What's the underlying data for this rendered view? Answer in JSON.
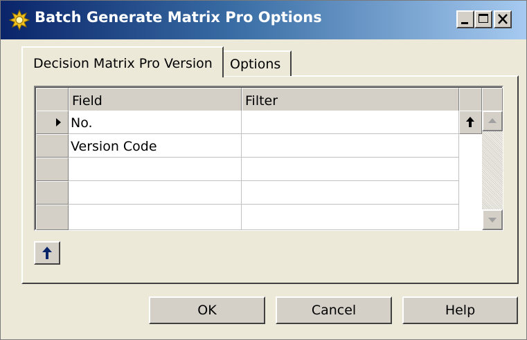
{
  "window": {
    "title": "Batch Generate Matrix Pro Options",
    "title_icon": "sun-gear-icon",
    "controls": [
      "minimize-icon",
      "maximize-icon",
      "close-icon"
    ],
    "title_bar_color": "#0a246a"
  },
  "tabs": [
    {
      "label": "Decision Matrix Pro Version",
      "active": true
    },
    {
      "label": "Options",
      "active": false
    }
  ],
  "grid": {
    "columns": [
      "Field",
      "Filter"
    ],
    "rows": [
      {
        "field": "No.",
        "filter": "",
        "current": true
      },
      {
        "field": "Version Code",
        "filter": ""
      },
      {
        "field": "",
        "filter": ""
      },
      {
        "field": "",
        "filter": ""
      },
      {
        "field": "",
        "filter": ""
      }
    ],
    "row_marker_icon": "current-row-arrow-icon",
    "field_lookup_icon": "arrow-up-icon",
    "scrollbar_up_icon": "scroll-up-icon",
    "scrollbar_down_icon": "scroll-down-icon"
  },
  "side_button_icon": "arrow-up-icon",
  "buttons": {
    "ok": "OK",
    "cancel": "Cancel",
    "help": "Help"
  }
}
